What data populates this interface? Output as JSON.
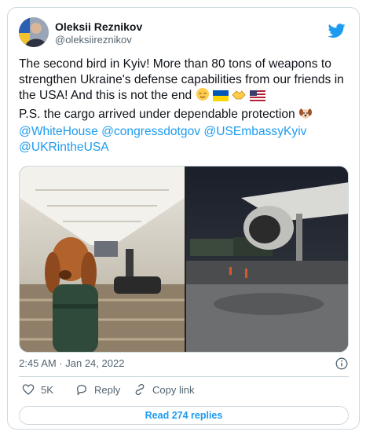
{
  "author": {
    "name": "Oleksii Reznikov",
    "handle": "@oleksiireznikov"
  },
  "tweet": {
    "line1": "The second bird in Kyiv! More than 80 tons of weapons to strengthen Ukraine's defense capabilities from our friends in the USA! And this is not the end",
    "line2": "P.S. the cargo arrived under dependable protection",
    "mentions": [
      "@WhiteHouse",
      "@congressdotgov",
      "@USEmbassyKyiv",
      "@UKRintheUSA"
    ]
  },
  "timestamp": "2:45 AM · Jan 24, 2022",
  "actions": {
    "likes": "5K",
    "reply": "Reply",
    "copy": "Copy link"
  },
  "read_replies": "Read 274 replies",
  "colors": {
    "accent": "#1d9bf0",
    "secondary_text": "#536471",
    "border": "#cfd9de"
  },
  "icons": [
    "twitter-bird-icon",
    "info-icon",
    "heart-icon",
    "reply-icon",
    "link-icon"
  ]
}
